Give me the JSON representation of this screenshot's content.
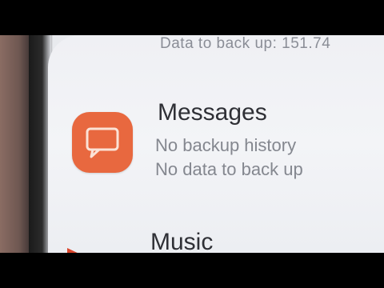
{
  "top_partial_text": "Data to back up: 151.74",
  "apps": {
    "messages": {
      "title": "Messages",
      "lines": [
        "No backup history",
        "No data to back up"
      ],
      "icon": "chat-bubble-icon",
      "color": "#e8683f"
    },
    "music": {
      "title": "Music",
      "icon": "play-triangle-icon"
    }
  }
}
